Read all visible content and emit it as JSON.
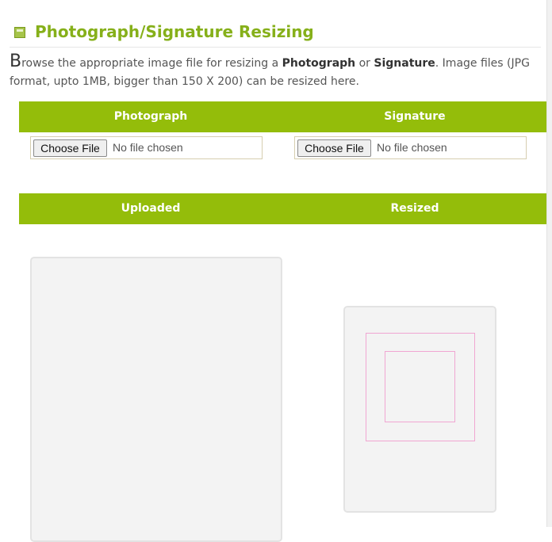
{
  "heading": {
    "title": "Photograph/Signature Resizing",
    "icon": "collapse-square-icon"
  },
  "intro": {
    "dropcap": "B",
    "part1": "rowse the appropriate image file for resizing a ",
    "photograph": "Photograph",
    "part2": " or ",
    "signature": "Signature",
    "part3": ". Image files (JPG format, upto 1MB, bigger than 150 X 200) can be resized here."
  },
  "upload_headers": {
    "photograph": "Photograph",
    "signature": "Signature"
  },
  "photo_input": {
    "button": "Choose File",
    "status": "No file chosen"
  },
  "signature_input": {
    "button": "Choose File",
    "status": "No file chosen"
  },
  "result_headers": {
    "uploaded": "Uploaded",
    "resized": "Resized"
  },
  "colors": {
    "accent": "#94bd0a",
    "title": "#86b01a",
    "crop_guide": "#f0a6d2"
  }
}
